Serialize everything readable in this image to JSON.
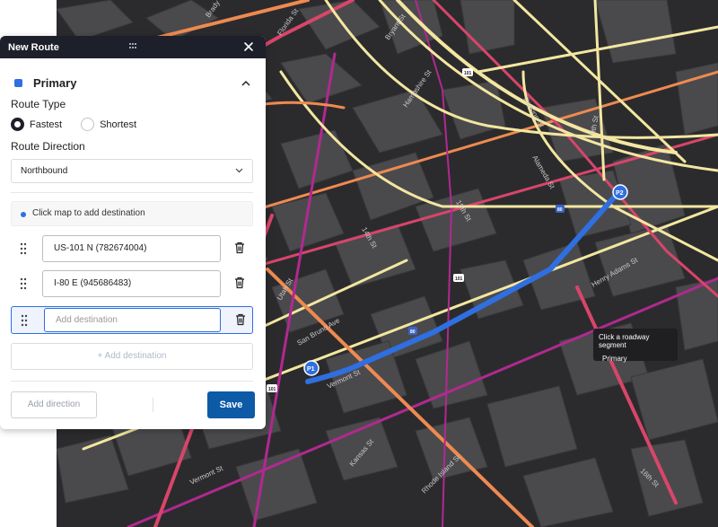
{
  "panel": {
    "title": "New Route",
    "route_name": "Primary",
    "route_color": "#2f6fe0",
    "route_type_label": "Route Type",
    "route_type_options": [
      {
        "label": "Fastest",
        "selected": true
      },
      {
        "label": "Shortest",
        "selected": false
      }
    ],
    "route_direction_label": "Route Direction",
    "route_direction_value": "Northbound",
    "hint": "Click map to add destination",
    "destinations": [
      {
        "value": "US-101 N (782674004)"
      },
      {
        "value": "I-80 E (945686483)"
      }
    ],
    "new_destination_placeholder": "Add destination",
    "add_destination_label": "+ Add destination",
    "add_direction_label": "Add direction",
    "save_label": "Save"
  },
  "map": {
    "tooltip_title": "Click a roadway segment",
    "tooltip_value": "Primary",
    "markers": [
      {
        "label": "P1"
      },
      {
        "label": "P2"
      }
    ],
    "street_labels": [
      "Brady St",
      "Florida St",
      "Bryant St",
      "Hampshire St",
      "Division St",
      "9th St",
      "15th St",
      "14th St",
      "Utah St",
      "San Bruno Ave",
      "Vermont St",
      "Henry Adams St",
      "Alameda St",
      "Rhode Island St",
      "Kansas St",
      "16th St",
      "Vermont St"
    ],
    "shields": [
      "101",
      "101",
      "80",
      "80",
      "101"
    ],
    "route_color": "#2f6fe0",
    "colors": {
      "background": "#2b2b2e",
      "building": "#4a4a4d",
      "road_yellow": "#f3e7a0",
      "road_orange": "#ef8a50",
      "road_red": "#d9456a",
      "road_magenta": "#b1298f"
    }
  }
}
